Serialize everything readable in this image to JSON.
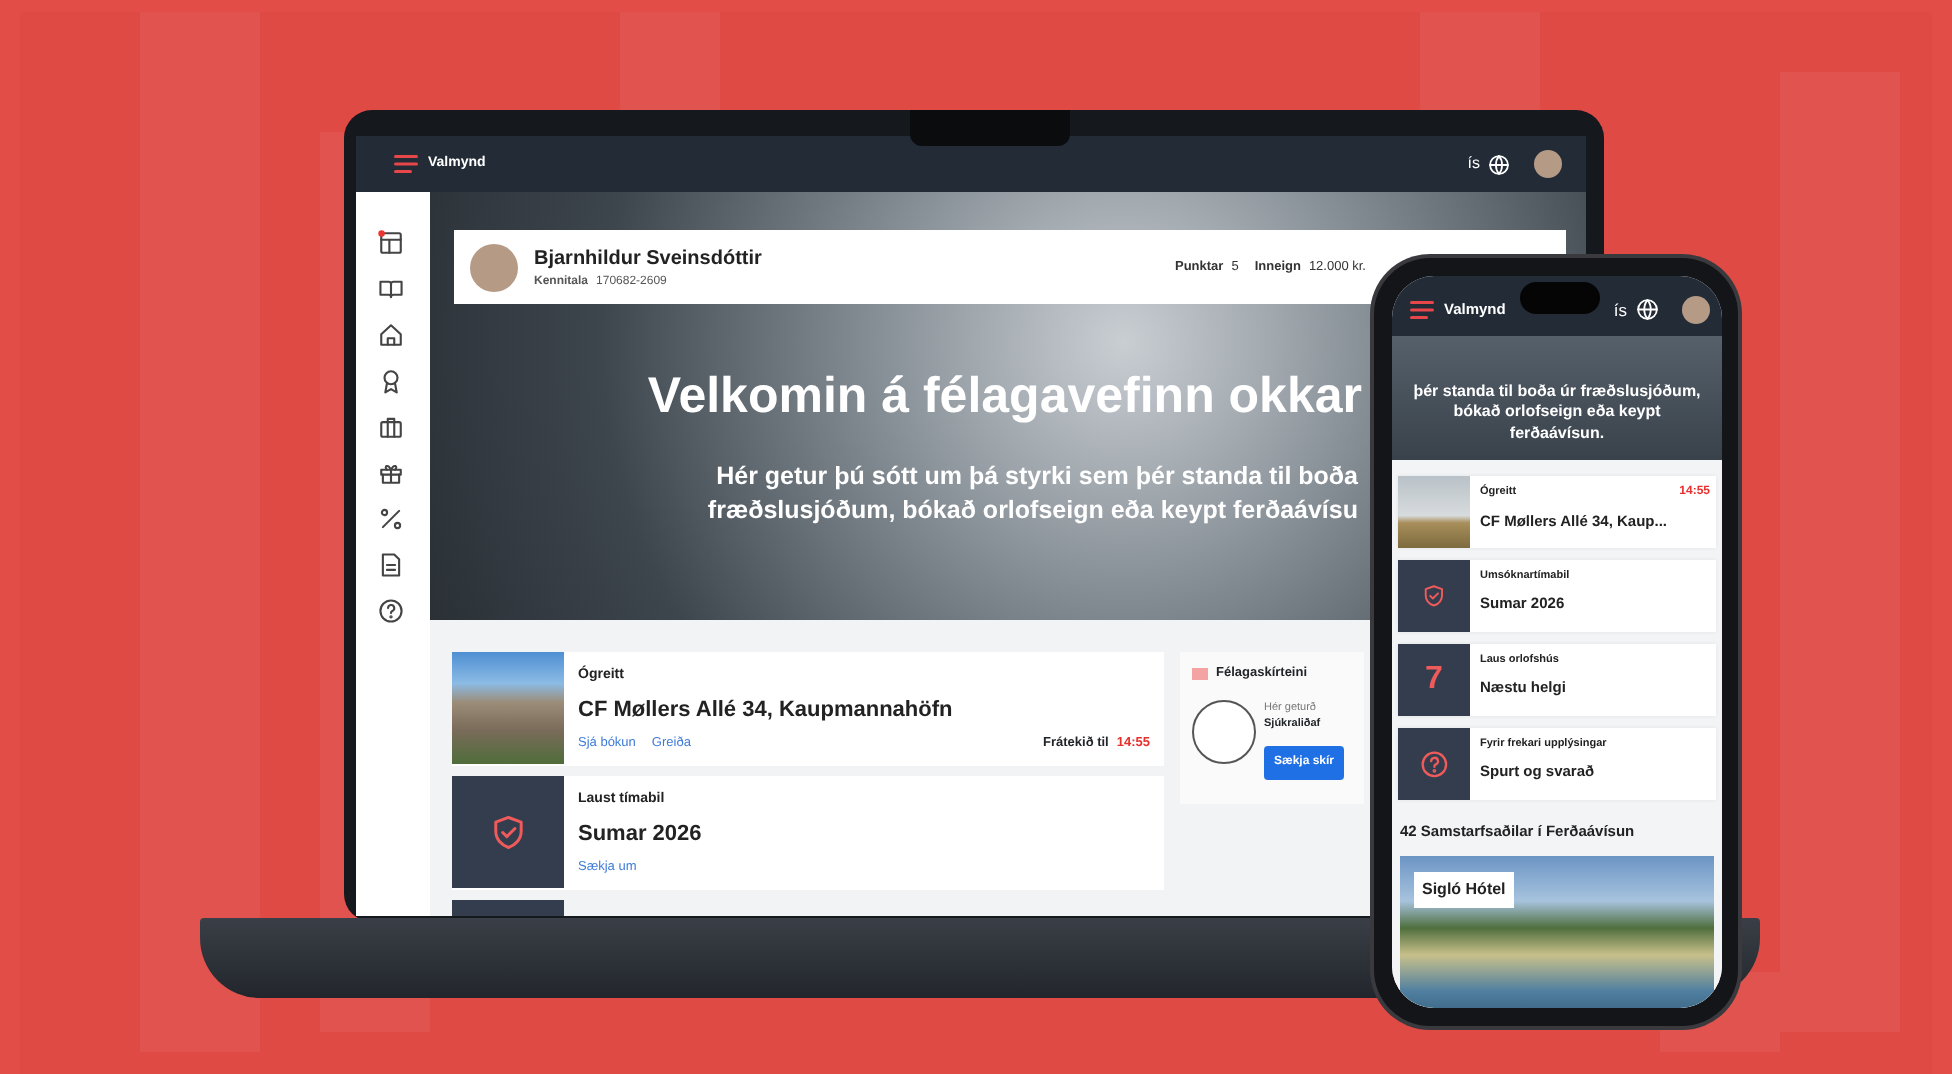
{
  "laptop": {
    "topbar": {
      "menu_label": "Valmynd",
      "language": "ís"
    },
    "sidebar": {
      "items": [
        {
          "kind": "dashboard",
          "notification": true
        },
        {
          "kind": "book",
          "notification": false
        },
        {
          "kind": "home",
          "notification": false
        },
        {
          "kind": "award",
          "notification": false
        },
        {
          "kind": "briefcase",
          "notification": false
        },
        {
          "kind": "gift",
          "notification": false
        },
        {
          "kind": "percent",
          "notification": false
        },
        {
          "kind": "document",
          "notification": false
        },
        {
          "kind": "question",
          "notification": false
        }
      ]
    },
    "profile": {
      "name": "Bjarnhildur Sveinsdóttir",
      "id_label": "Kennitala",
      "id_value": "170682-2609",
      "points_label": "Punktar",
      "points_value": "5",
      "balance_label": "Inneign",
      "balance_value": "12.000 kr."
    },
    "hero": {
      "title": "Velkomin á félagavefinn okkar",
      "subtitle_lines": [
        "Hér getur þú sótt um þá styrki sem þér standa til boða",
        "fræðslusjóðum, bókað orlofseign eða keypt ferðaávísu"
      ]
    },
    "cards": [
      {
        "kind": "photo",
        "label": "Ógreitt",
        "title": "CF Møllers Allé 34, Kaupmannahöfn",
        "links": [
          "Sjá bókun",
          "Greiða"
        ],
        "reserved_label": "Frátekið til",
        "reserved_time": "14:55"
      },
      {
        "kind": "shield",
        "label": "Laust tímabil",
        "title": "Sumar 2026",
        "links": [
          "Sækja um"
        ]
      }
    ],
    "member_card": {
      "title": "Félagaskírteini",
      "text": "Hér geturð",
      "org": "Sjúkraliðaf",
      "button": "Sækja skír"
    }
  },
  "phone": {
    "topbar": {
      "menu_label": "Valmynd",
      "language": "ís"
    },
    "hero_text": "þér standa til boða úr fræðslusjóðum, bókað orlofseign eða keypt ferðaávísun.",
    "cards": [
      {
        "kind": "photo",
        "label": "Ógreitt",
        "time": "14:55",
        "title": "CF Møllers Allé 34, Kaup..."
      },
      {
        "kind": "shield",
        "label": "Umsóknartímabil",
        "title": "Sumar 2026"
      },
      {
        "kind": "number",
        "number": "7",
        "label": "Laus orlofshús",
        "title": "Næstu helgi"
      },
      {
        "kind": "question",
        "label": "Fyrir frekari upplýsingar",
        "title": "Spurt og svarað"
      }
    ],
    "partners_title": "42 Samstarfsaðilar í Ferðaávísun",
    "featured": {
      "name": "Sigló Hótel"
    }
  }
}
